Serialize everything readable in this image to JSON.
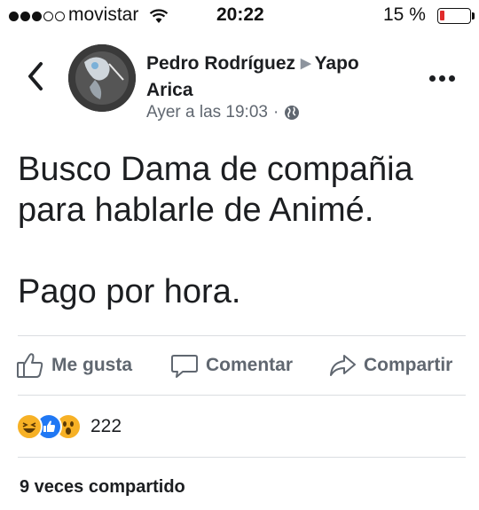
{
  "status_bar": {
    "carrier": "movistar",
    "time": "20:22",
    "battery": "15 %",
    "battery_level": 0.15,
    "signal_bars_filled": 3,
    "signal_bars_total": 5
  },
  "post": {
    "author": "Pedro Rodríguez",
    "group": "Yapo Arica",
    "group_line1": "Yapo",
    "group_line2": "Arica",
    "timestamp": "Ayer a las 19:03",
    "separator": "·",
    "privacy_icon": "globe-icon",
    "text_line1": "Busco Dama de compañia",
    "text_line2": "para hablarle de Animé.",
    "text_line3": "Pago por hora."
  },
  "actions": {
    "like": "Me gusta",
    "comment": "Comentar",
    "share": "Compartir"
  },
  "reactions": {
    "icons": [
      "haha-icon",
      "like-icon",
      "wow-icon"
    ],
    "count": "222"
  },
  "shares": "9 veces compartido",
  "colors": {
    "text": "#1c1e21",
    "secondary": "#606770",
    "like_blue": "#2078f4",
    "emoji_yellow": "#f7b125",
    "battery_red": "#e02b2b"
  }
}
